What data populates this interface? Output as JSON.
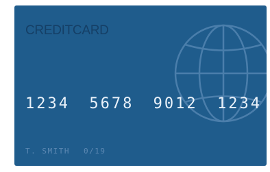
{
  "card": {
    "brand_title": "CREDITCARD",
    "number_groups": [
      "1234",
      "5678",
      "9012",
      "1234"
    ],
    "cardholder_name": "T. SMITH",
    "expiry": "0/19",
    "colors": {
      "card_background": "#1f5c8c",
      "title_text": "#153f66",
      "number_text": "#eaf2fa",
      "holder_text": "#5d89b3",
      "globe_lines": "#5a8ab6"
    },
    "icon": "globe-icon"
  }
}
